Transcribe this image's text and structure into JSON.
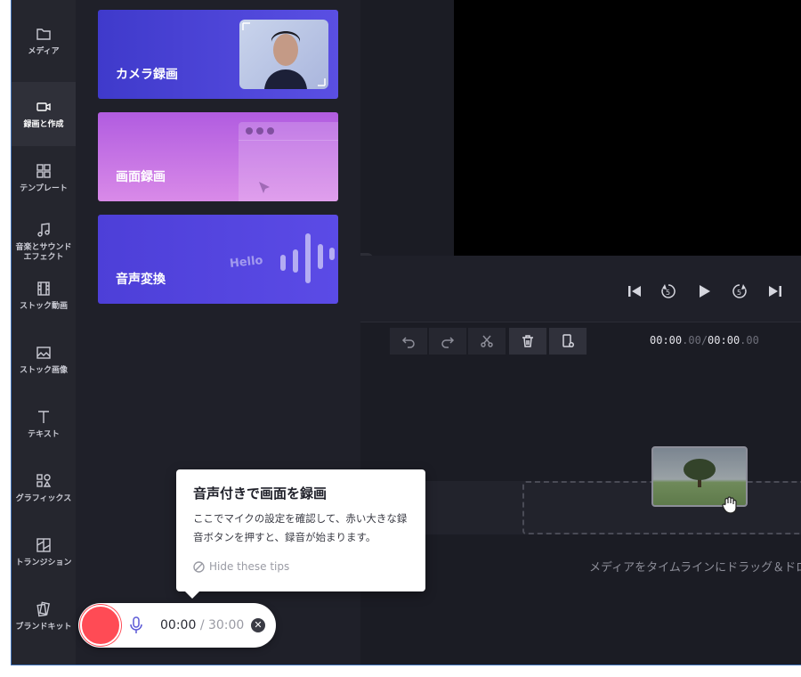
{
  "sidebar": {
    "items": [
      {
        "label": "メディア",
        "icon": "folder-icon"
      },
      {
        "label": "録画と作成",
        "icon": "video-camera-icon"
      },
      {
        "label": "テンプレート",
        "icon": "templates-icon"
      },
      {
        "label": "音楽とサウンド\nエフェクト",
        "icon": "music-note-icon"
      },
      {
        "label": "ストック動画",
        "icon": "film-icon"
      },
      {
        "label": "ストック画像",
        "icon": "image-icon"
      },
      {
        "label": "テキスト",
        "icon": "text-icon"
      },
      {
        "label": "グラフィックス",
        "icon": "shapes-icon"
      },
      {
        "label": "トランジション",
        "icon": "transition-icon"
      },
      {
        "label": "ブランドキット",
        "icon": "brand-kit-icon"
      }
    ],
    "active_index": 1
  },
  "panel": {
    "cards": [
      {
        "label": "カメラ録画"
      },
      {
        "label": "画面録画"
      },
      {
        "label": "音声変換",
        "art_text": "Hello"
      }
    ]
  },
  "toolbar": {
    "time_current_main": "00:00",
    "time_current_frac": ".00",
    "time_separator": "/",
    "time_total_main": "00:00",
    "time_total_frac": ".00"
  },
  "timeline": {
    "drop_hint": "メディアをタイムラインにドラッグ＆ドロップ"
  },
  "tooltip": {
    "title": "音声付きで画面を録画",
    "body": "ここでマイクの設定を確認して、赤い大きな録音ボタンを押すと、録音が始まります。",
    "hide_label": "Hide these tips"
  },
  "recorder": {
    "elapsed": "00:00",
    "separator": "/",
    "limit": "30:00",
    "close_glyph": "✕"
  },
  "colors": {
    "record_red": "#ff4b55",
    "mic_accent": "#5b59d6",
    "sidebar_bg": "#25262e",
    "app_bg": "#1b1c24"
  }
}
